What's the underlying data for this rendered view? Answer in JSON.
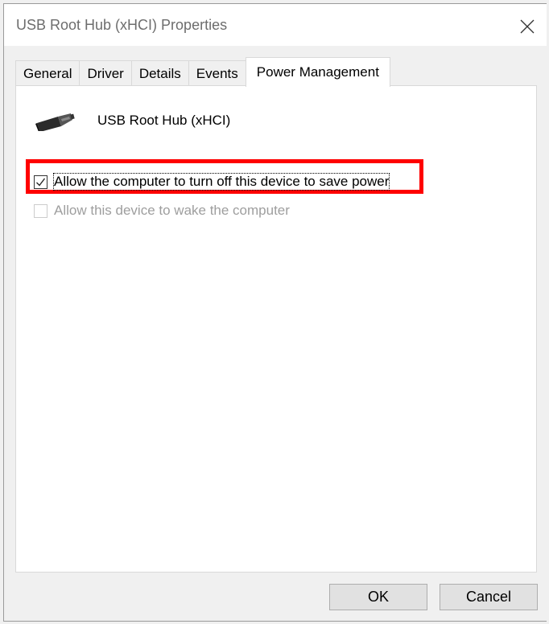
{
  "window": {
    "title": "USB Root Hub (xHCI) Properties"
  },
  "tabs": [
    {
      "label": "General",
      "active": false
    },
    {
      "label": "Driver",
      "active": false
    },
    {
      "label": "Details",
      "active": false
    },
    {
      "label": "Events",
      "active": false
    },
    {
      "label": "Power Management",
      "active": true
    }
  ],
  "device": {
    "name": "USB Root Hub (xHCI)",
    "icon": "usb-plug-icon"
  },
  "options": {
    "allow_turn_off": {
      "label": "Allow the computer to turn off this device to save power",
      "checked": true,
      "enabled": true
    },
    "allow_wake": {
      "label": "Allow this device to wake the computer",
      "checked": false,
      "enabled": false
    }
  },
  "buttons": {
    "ok_label": "OK",
    "cancel_label": "Cancel"
  },
  "colors": {
    "highlight": "#ff0000",
    "panel_bg": "#ffffff",
    "window_bg": "#f0f0f0",
    "disabled_text": "#9e9e9e"
  }
}
